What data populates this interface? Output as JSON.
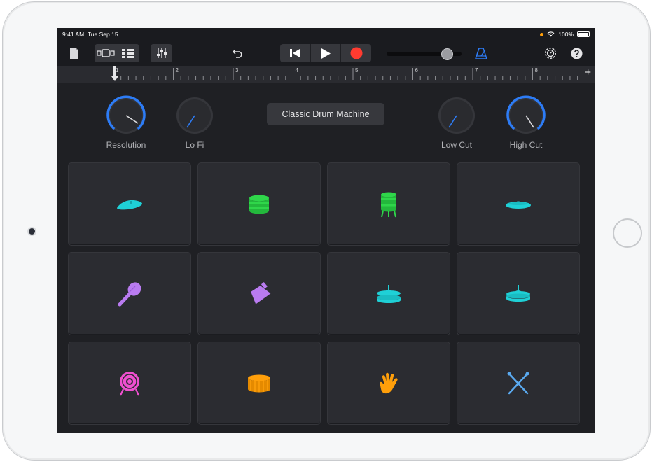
{
  "status_bar": {
    "time": "9:41 AM",
    "date": "Tue Sep 15",
    "battery": "100%"
  },
  "toolbar": {
    "icons": [
      "my-songs-icon",
      "tracks-view-icon",
      "grid-view-icon",
      "mixer-icon",
      "undo-icon",
      "go-to-beginning-icon",
      "play-icon",
      "record-icon",
      "metronome-icon",
      "settings-icon",
      "help-icon"
    ],
    "master_volume": 0.8,
    "accent_color": "#2d7cf6",
    "record_color": "#ff3b30"
  },
  "ruler": {
    "bars": [
      "1",
      "2",
      "3",
      "4",
      "5",
      "6",
      "7",
      "8"
    ],
    "add_section": "+"
  },
  "knobs": {
    "resolution": {
      "label": "Resolution",
      "value": 0.9
    },
    "lo_fi": {
      "label": "Lo Fi",
      "value": 0.1
    },
    "low_cut": {
      "label": "Low Cut",
      "value": 0.1
    },
    "high_cut": {
      "label": "High Cut",
      "value": 0.9
    }
  },
  "preset": {
    "label": "Classic Drum Machine"
  },
  "pads": [
    {
      "icon": "crash-cymbal-icon",
      "color": "#1fd0d6"
    },
    {
      "icon": "snare-drum-icon",
      "color": "#2fd64a"
    },
    {
      "icon": "floor-tom-icon",
      "color": "#2fd64a"
    },
    {
      "icon": "ride-cymbal-icon",
      "color": "#1fd0d6"
    },
    {
      "icon": "maraca-icon",
      "color": "#b97bf0"
    },
    {
      "icon": "cowbell-icon",
      "color": "#b97bf0"
    },
    {
      "icon": "hi-hat-icon",
      "color": "#1fd0d6"
    },
    {
      "icon": "hi-hat-closed-icon",
      "color": "#1fd0d6"
    },
    {
      "icon": "kick-drum-icon",
      "color": "#f04fd0"
    },
    {
      "icon": "drum-icon",
      "color": "#ff9f0a"
    },
    {
      "icon": "clap-hand-icon",
      "color": "#ff9f0a"
    },
    {
      "icon": "drumsticks-icon",
      "color": "#5aaaf0"
    }
  ]
}
